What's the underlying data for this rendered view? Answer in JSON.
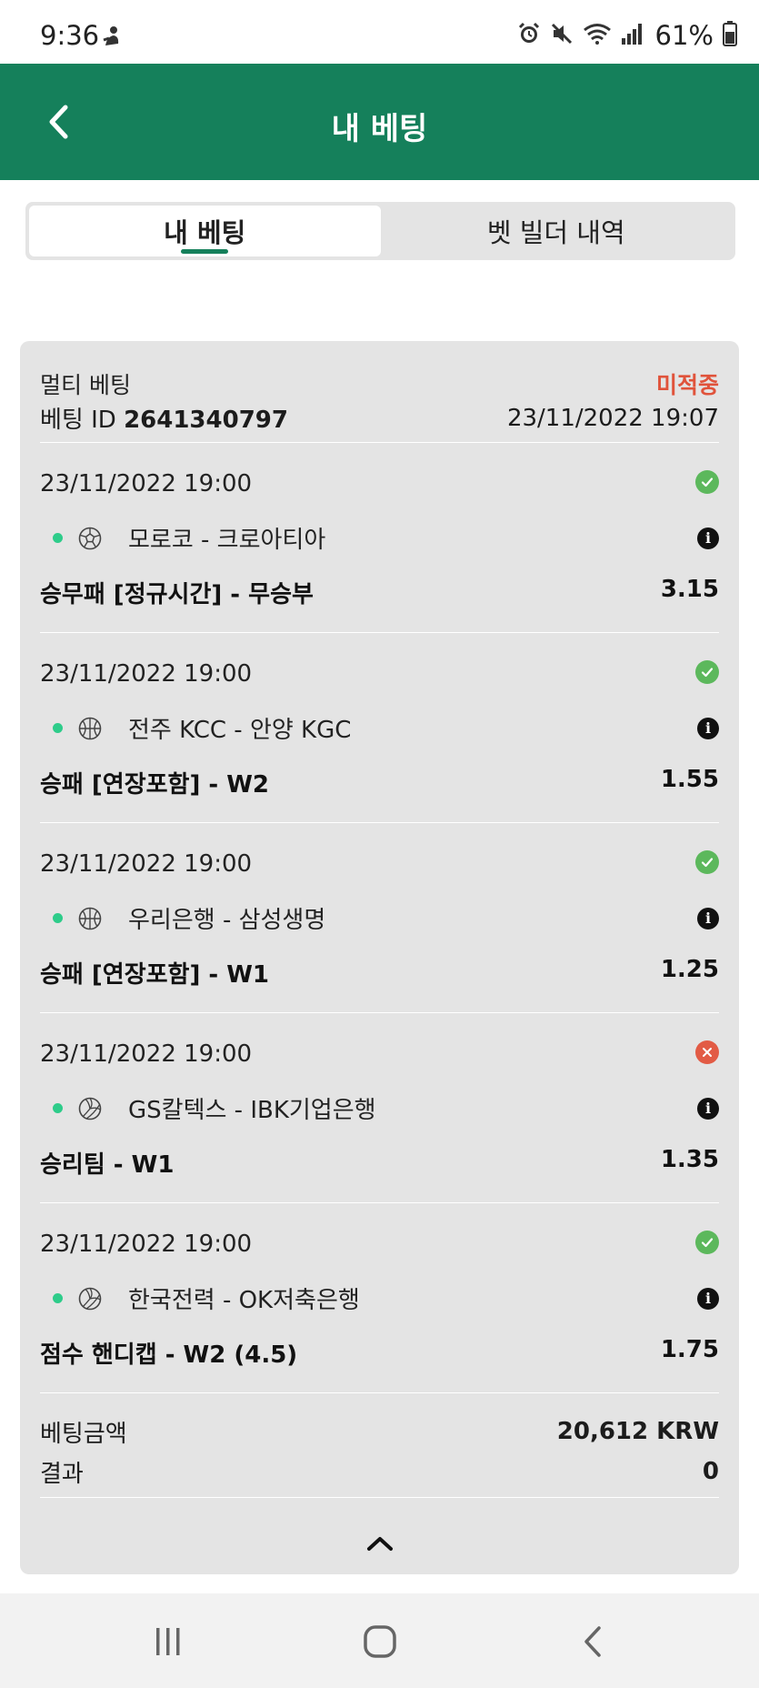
{
  "status_bar": {
    "time": "9:36",
    "battery": "61%",
    "icons": [
      "alarm-icon",
      "mute-icon",
      "wifi-icon",
      "signal-icon",
      "battery-icon"
    ]
  },
  "header": {
    "title": "내 베팅",
    "bg_color": "#15805b"
  },
  "tabs": [
    {
      "label": "내 베팅",
      "active": true
    },
    {
      "label": "벳 빌더 내역",
      "active": false
    }
  ],
  "bet": {
    "type": "멀티 베팅",
    "status": "미적중",
    "id_label": "베팅 ID",
    "id": "2641340797",
    "placed_at": "23/11/2022 19:07",
    "selections": [
      {
        "date": "23/11/2022 19:00",
        "result": "won",
        "sport": "soccer",
        "match": "모로코 - 크로아티아",
        "market": "승무패 [정규시간] - 무승부",
        "odds": "3.15"
      },
      {
        "date": "23/11/2022 19:00",
        "result": "won",
        "sport": "basketball",
        "match": "전주 KCC - 안양 KGC",
        "market": "승패 [연장포함] - W2",
        "odds": "1.55"
      },
      {
        "date": "23/11/2022 19:00",
        "result": "won",
        "sport": "basketball",
        "match": "우리은행 - 삼성생명",
        "market": "승패 [연장포함] - W1",
        "odds": "1.25"
      },
      {
        "date": "23/11/2022 19:00",
        "result": "lost",
        "sport": "volleyball",
        "match": "GS칼텍스 - IBK기업은행",
        "market": "승리팀 - W1",
        "odds": "1.35"
      },
      {
        "date": "23/11/2022 19:00",
        "result": "won",
        "sport": "volleyball",
        "match": "한국전력 - OK저축은행",
        "market": "점수 핸디캡 - W2 (4.5)",
        "odds": "1.75"
      }
    ],
    "stake_label": "베팅금액",
    "stake": "20,612 KRW",
    "result_label": "결과",
    "result_value": "0"
  },
  "colors": {
    "accent": "#15805b",
    "won": "#5cb85c",
    "lost": "#e25b45",
    "status_text": "#e0533b",
    "live_dot": "#2ecc8a"
  }
}
